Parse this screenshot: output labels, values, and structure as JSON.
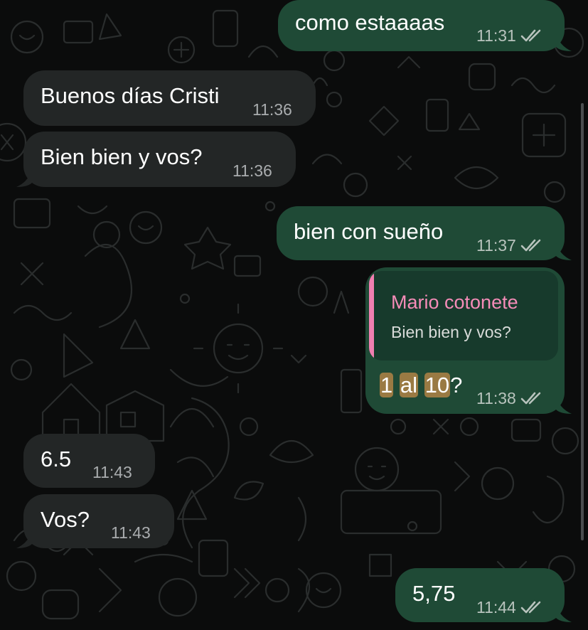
{
  "theme": {
    "background": "#0b0c0c",
    "incoming_bubble": "#232626",
    "outgoing_bubble": "#1f4a36",
    "quote_background": "#173a2c",
    "quote_accent": "#f07fb0",
    "search_highlight": "#9a7a43"
  },
  "messages": [
    {
      "direction": "outgoing",
      "text": "como estaaaas",
      "time": "11:31",
      "status": "read",
      "status_icon": "double-check-icon"
    },
    {
      "direction": "incoming",
      "text": "Buenos días Cristi",
      "time": "11:36"
    },
    {
      "direction": "incoming",
      "text": "Bien bien y vos?",
      "time": "11:36"
    },
    {
      "direction": "outgoing",
      "text": "bien con sueño",
      "time": "11:37",
      "status": "read",
      "status_icon": "double-check-icon"
    },
    {
      "direction": "outgoing",
      "quote": {
        "author": "Mario cotonete",
        "text": "Bien bien y vos?"
      },
      "text_parts": [
        "1",
        " ",
        "al",
        " ",
        "10",
        "?"
      ],
      "highlighted_parts": [
        "1",
        "al",
        "10"
      ],
      "time": "11:38",
      "status": "read",
      "status_icon": "double-check-icon"
    },
    {
      "direction": "incoming",
      "text": "6.5",
      "time": "11:43"
    },
    {
      "direction": "incoming",
      "text": "Vos?",
      "time": "11:43"
    },
    {
      "direction": "outgoing",
      "text": "5,75",
      "time": "11:44",
      "status": "read",
      "status_icon": "double-check-icon"
    }
  ]
}
